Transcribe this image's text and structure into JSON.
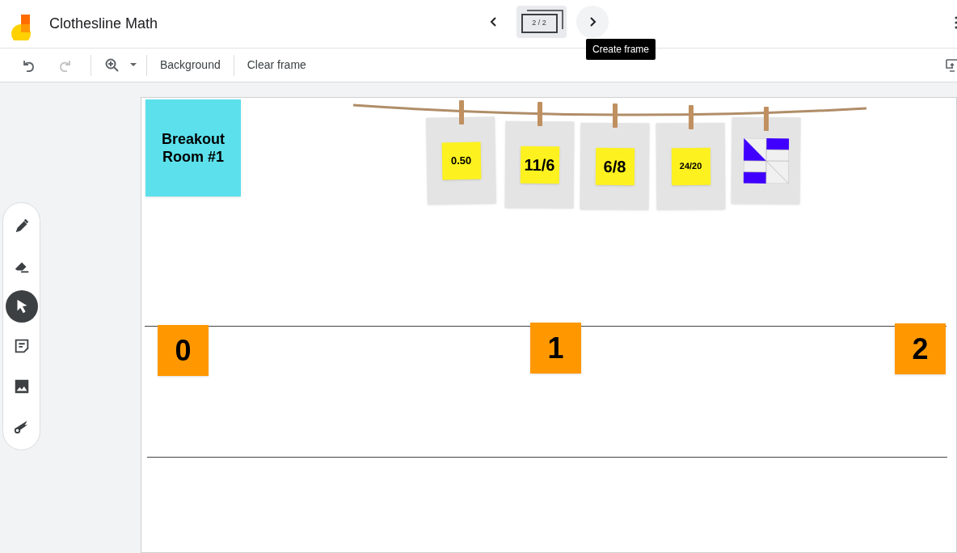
{
  "app": {
    "title": "Clothesline Math"
  },
  "frame_nav": {
    "counter": "2 / 2",
    "tooltip": "Create frame"
  },
  "toolbar": {
    "undo": {
      "disabled": false
    },
    "redo": {
      "disabled": true
    },
    "buttons": [
      "Background",
      "Clear frame"
    ]
  },
  "tools": [
    {
      "kind": "pen",
      "selected": false
    },
    {
      "kind": "eraser",
      "selected": false
    },
    {
      "kind": "select",
      "selected": true
    },
    {
      "kind": "note",
      "selected": false
    },
    {
      "kind": "image",
      "selected": false
    },
    {
      "kind": "laser",
      "selected": false
    }
  ],
  "canvas": {
    "title_note": {
      "text": "Breakout Room #1",
      "color": "#5ce1ec"
    },
    "clothesline": [
      {
        "kind": "note",
        "text": "0.50",
        "color": "#fdf21f"
      },
      {
        "kind": "note",
        "text": "11/6",
        "color": "#fdf21f"
      },
      {
        "kind": "note",
        "text": "6/8",
        "color": "#fdf21f"
      },
      {
        "kind": "note",
        "text": "24/20",
        "color": "#fdf21f"
      },
      {
        "kind": "fraction-picture"
      }
    ],
    "number_line": [
      {
        "text": "0",
        "color": "#ff9800"
      },
      {
        "text": "1",
        "color": "#ff9800"
      },
      {
        "text": "2",
        "color": "#ff9800"
      }
    ]
  }
}
